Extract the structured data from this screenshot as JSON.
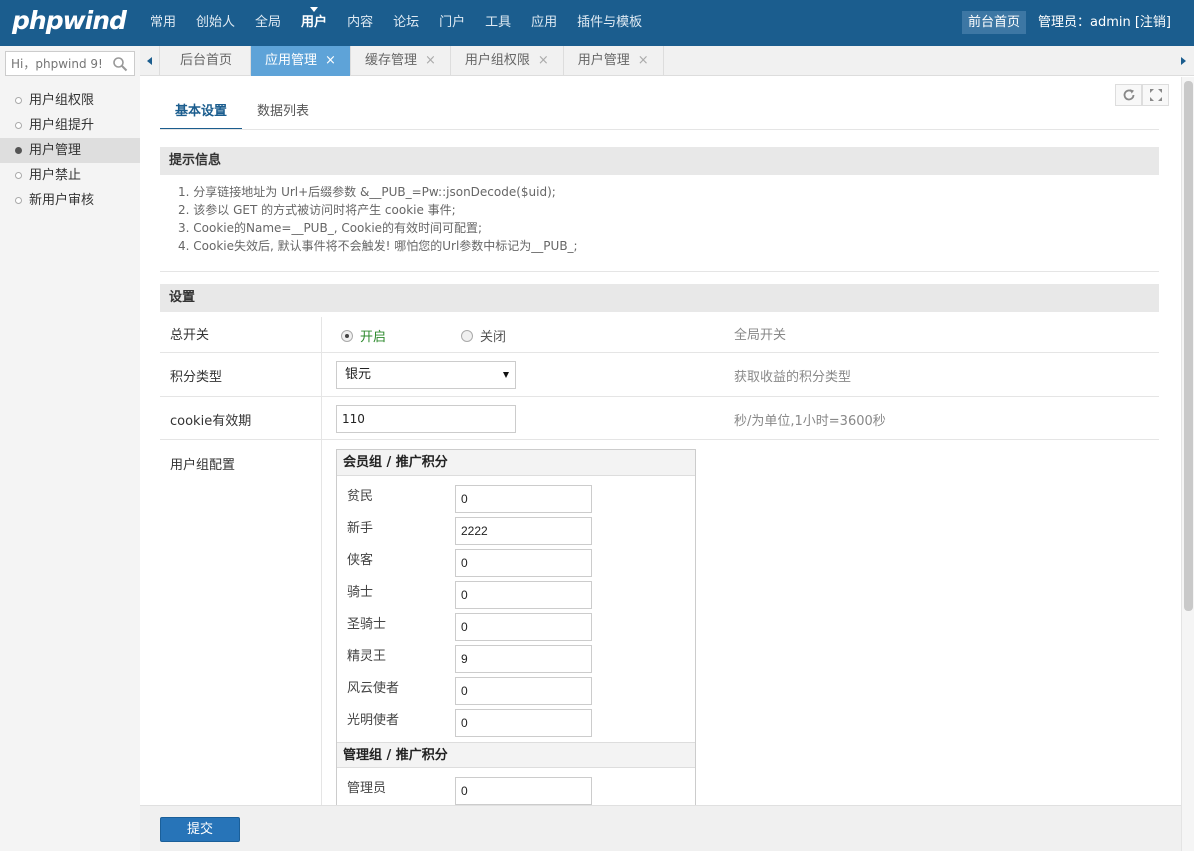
{
  "header": {
    "logo": "phpwind",
    "nav": [
      "常用",
      "创始人",
      "全局",
      "用户",
      "内容",
      "论坛",
      "门户",
      "工具",
      "应用",
      "插件与模板"
    ],
    "active_nav": "用户",
    "front_home": "前台首页",
    "admin_label": "管理员：admin [注销]"
  },
  "sidebar": {
    "search_placeholder": "Hi，phpwind 9!",
    "items": [
      "用户组权限",
      "用户组提升",
      "用户管理",
      "用户禁止",
      "新用户审核"
    ],
    "active_index": 2
  },
  "tabs": [
    {
      "label": "后台首页"
    },
    {
      "label": "应用管理",
      "close": "×"
    },
    {
      "label": "缓存管理",
      "close": "×"
    },
    {
      "label": "用户组权限",
      "close": "×"
    },
    {
      "label": "用户管理",
      "close": "×"
    }
  ],
  "subtabs": [
    "基本设置",
    "数据列表"
  ],
  "tips": {
    "title": "提示信息",
    "items": [
      "1.  分享链接地址为 Url+后缀参数 &__PUB_=Pw::jsonDecode($uid);",
      "2.  该参以 GET 的方式被访问时将产生 cookie 事件;",
      "3.  Cookie的Name=__PUB_, Cookie的有效时间可配置;",
      "4.  Cookie失效后, 默认事件将不会触发! 哪怕您的Url参数中标记为__PUB_;"
    ]
  },
  "settings": {
    "title": "设置",
    "switch": {
      "label": "总开关",
      "on": "开启",
      "off": "关闭",
      "desc": "全局开关"
    },
    "credit": {
      "label": "积分类型",
      "value": "银元",
      "desc": "获取收益的积分类型"
    },
    "cookie": {
      "label": "cookie有效期",
      "value": "110",
      "desc": "秒/为单位,1小时=3600秒"
    },
    "groups": {
      "label": "用户组配置",
      "member_title": "会员组 / 推广积分",
      "members": [
        {
          "name": "贫民",
          "value": "0"
        },
        {
          "name": "新手",
          "value": "2222"
        },
        {
          "name": "侠客",
          "value": "0"
        },
        {
          "name": "骑士",
          "value": "0"
        },
        {
          "name": "圣骑士",
          "value": "0"
        },
        {
          "name": "精灵王",
          "value": "9"
        },
        {
          "name": "风云使者",
          "value": "0"
        },
        {
          "name": "光明使者",
          "value": "0"
        }
      ],
      "admin_title": "管理组 / 推广积分",
      "admins": [
        {
          "name": "管理员",
          "value": "0"
        }
      ]
    }
  },
  "footer": {
    "submit": "提交"
  }
}
